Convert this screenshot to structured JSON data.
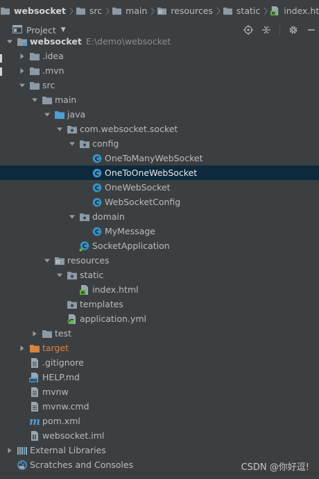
{
  "breadcrumb": [
    {
      "label": "websocket",
      "icon": "folder-icon"
    },
    {
      "label": "src",
      "icon": "folder-icon"
    },
    {
      "label": "main",
      "icon": "folder-icon"
    },
    {
      "label": "resources",
      "icon": "resources-folder-icon"
    },
    {
      "label": "static",
      "icon": "folder-icon"
    },
    {
      "label": "index.html",
      "icon": "html-file-icon"
    }
  ],
  "tool_window": {
    "title": "Project",
    "actions": [
      "target-icon",
      "collapse-all-icon",
      "gear-icon",
      "minimize-icon"
    ]
  },
  "tree": [
    {
      "label": "websocket",
      "sub": "E:\\demo\\websocket",
      "depth": 0,
      "arrow": "down",
      "icon": "module",
      "bold": true
    },
    {
      "label": ".idea",
      "depth": 1,
      "arrow": "right",
      "icon": "folder"
    },
    {
      "label": ".mvn",
      "depth": 1,
      "arrow": "right",
      "icon": "folder"
    },
    {
      "label": "src",
      "depth": 1,
      "arrow": "down",
      "icon": "folder"
    },
    {
      "label": "main",
      "depth": 2,
      "arrow": "down",
      "icon": "folder"
    },
    {
      "label": "java",
      "depth": 3,
      "arrow": "down",
      "icon": "source-folder"
    },
    {
      "label": "com.websocket.socket",
      "depth": 4,
      "arrow": "down",
      "icon": "package"
    },
    {
      "label": "config",
      "depth": 5,
      "arrow": "down",
      "icon": "package"
    },
    {
      "label": "OneToManyWebSocket",
      "depth": 6,
      "arrow": "none",
      "icon": "class"
    },
    {
      "label": "OneToOneWebSocket",
      "depth": 6,
      "arrow": "none",
      "icon": "class",
      "selected": true
    },
    {
      "label": "OneWebSocket",
      "depth": 6,
      "arrow": "none",
      "icon": "class"
    },
    {
      "label": "WebSocketConfig",
      "depth": 6,
      "arrow": "none",
      "icon": "class"
    },
    {
      "label": "domain",
      "depth": 5,
      "arrow": "down",
      "icon": "package"
    },
    {
      "label": "MyMessage",
      "depth": 6,
      "arrow": "none",
      "icon": "class"
    },
    {
      "label": "SocketApplication",
      "depth": 5,
      "arrow": "none",
      "icon": "spring-class"
    },
    {
      "label": "resources",
      "depth": 3,
      "arrow": "down",
      "icon": "resources-folder"
    },
    {
      "label": "static",
      "depth": 4,
      "arrow": "down",
      "icon": "package"
    },
    {
      "label": "index.html",
      "depth": 5,
      "arrow": "none",
      "icon": "html"
    },
    {
      "label": "templates",
      "depth": 4,
      "arrow": "none",
      "icon": "package"
    },
    {
      "label": "application.yml",
      "depth": 4,
      "arrow": "none",
      "icon": "yml"
    },
    {
      "label": "test",
      "depth": 2,
      "arrow": "right",
      "icon": "folder"
    },
    {
      "label": "target",
      "depth": 1,
      "arrow": "right",
      "icon": "excluded-folder",
      "excluded": true
    },
    {
      "label": ".gitignore",
      "depth": 1,
      "arrow": "none",
      "icon": "text-file"
    },
    {
      "label": "HELP.md",
      "depth": 1,
      "arrow": "none",
      "icon": "md-file"
    },
    {
      "label": "mvnw",
      "depth": 1,
      "arrow": "none",
      "icon": "text-file"
    },
    {
      "label": "mvnw.cmd",
      "depth": 1,
      "arrow": "none",
      "icon": "text-file"
    },
    {
      "label": "pom.xml",
      "depth": 1,
      "arrow": "none",
      "icon": "maven-file"
    },
    {
      "label": "websocket.iml",
      "depth": 1,
      "arrow": "none",
      "icon": "iml-file"
    },
    {
      "label": "External Libraries",
      "depth": 0,
      "arrow": "right",
      "icon": "libraries"
    },
    {
      "label": "Scratches and Consoles",
      "depth": 0,
      "arrow": "none",
      "icon": "scratches"
    }
  ],
  "watermark": "CSDN @你好逗!",
  "colors": {
    "background": "#3c3f41",
    "selection": "#0d293e",
    "text": "#bbbbbb",
    "folder": "#8c9aa6",
    "source_folder": "#4e9ed8",
    "class_icon": "#3592c4",
    "excluded": "#d68443"
  }
}
